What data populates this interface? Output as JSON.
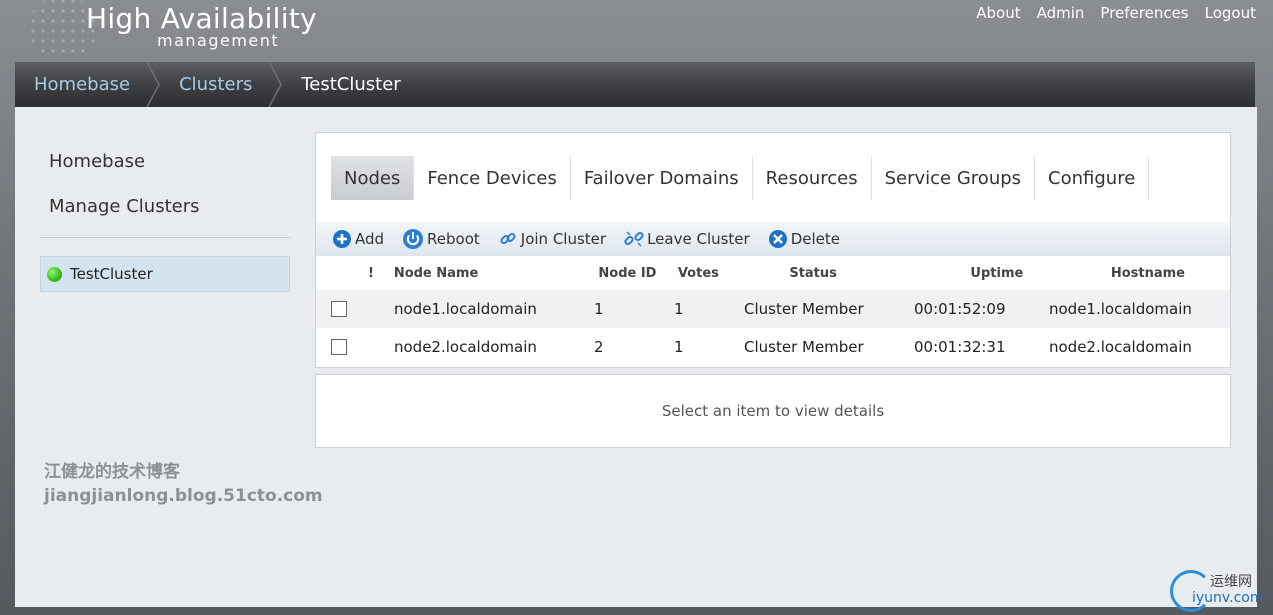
{
  "header": {
    "logo_title": "High Availability",
    "logo_subtitle": "management",
    "nav": [
      "About",
      "Admin",
      "Preferences",
      "Logout"
    ]
  },
  "breadcrumb": [
    "Homebase",
    "Clusters",
    "TestCluster"
  ],
  "sidebar": {
    "links": [
      "Homebase",
      "Manage Clusters"
    ],
    "cluster": {
      "name": "TestCluster",
      "status_color": "#3ac21a"
    },
    "watermark_cn": "江健龙的技术博客",
    "watermark_url": "jiangjianlong.blog.51cto.com"
  },
  "tabs": [
    "Nodes",
    "Fence Devices",
    "Failover Domains",
    "Resources",
    "Service Groups",
    "Configure"
  ],
  "active_tab": "Nodes",
  "toolbar": {
    "add": "Add",
    "reboot": "Reboot",
    "join": "Join Cluster",
    "leave": "Leave Cluster",
    "delete": "Delete"
  },
  "table": {
    "headers": {
      "bang": "!",
      "name": "Node Name",
      "id": "Node ID",
      "votes": "Votes",
      "status": "Status",
      "uptime": "Uptime",
      "hostname": "Hostname"
    },
    "rows": [
      {
        "name": "node1.localdomain",
        "id": "1",
        "votes": "1",
        "status": "Cluster Member",
        "uptime": "00:01:52:09",
        "hostname": "node1.localdomain"
      },
      {
        "name": "node2.localdomain",
        "id": "2",
        "votes": "1",
        "status": "Cluster Member",
        "uptime": "00:01:32:31",
        "hostname": "node2.localdomain"
      }
    ]
  },
  "details_text": "Select an item to view details",
  "brand": {
    "cn": "运维网",
    "en": "iyunv.com"
  }
}
